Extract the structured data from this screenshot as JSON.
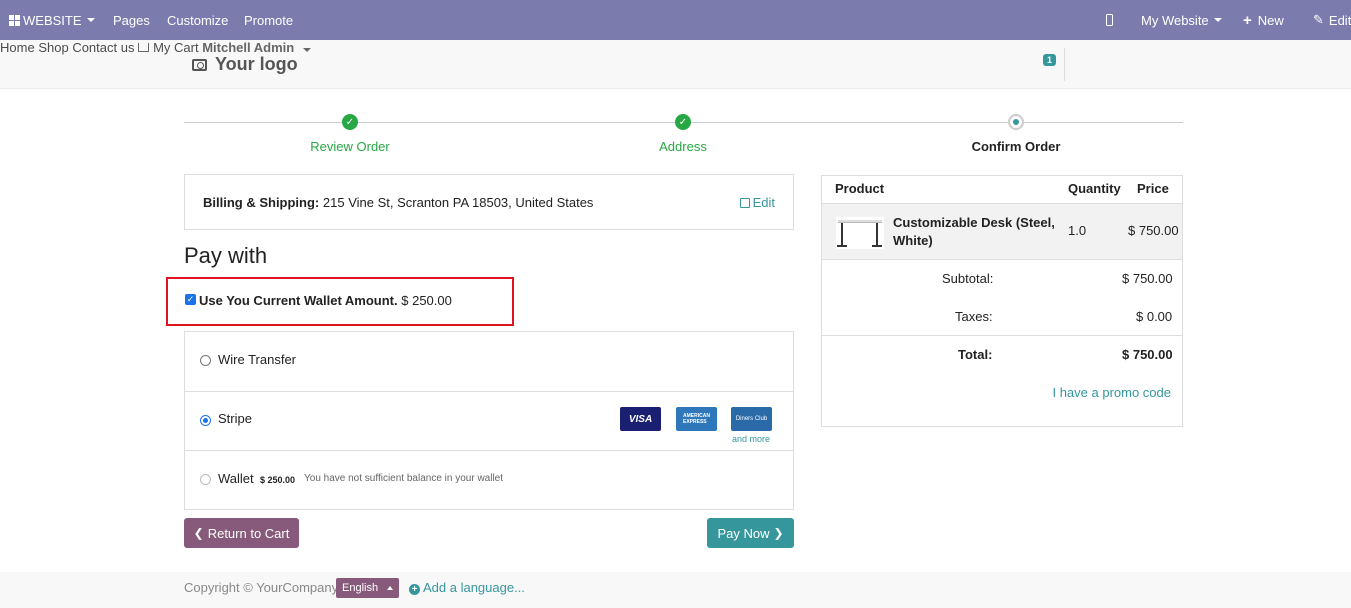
{
  "adminbar": {
    "website_label": "WEBSITE",
    "pages_label": "Pages",
    "customize_label": "Customize",
    "promote_label": "Promote",
    "mywebsite_label": "My Website",
    "new_label": "New",
    "edit_label": "Edit"
  },
  "header": {
    "logo_text": "Your logo",
    "nav": {
      "home": "Home",
      "shop": "Shop",
      "contact": "Contact us",
      "cart": "My Cart",
      "cart_count": "1",
      "user": "Mitchell Admin"
    }
  },
  "steps": [
    {
      "label": "Review Order",
      "state": "done"
    },
    {
      "label": "Address",
      "state": "done"
    },
    {
      "label": "Confirm Order",
      "state": "current"
    }
  ],
  "billing": {
    "label": "Billing & Shipping:",
    "address": "215 Vine St, Scranton PA 18503, United States",
    "edit_label": "Edit"
  },
  "pay_with_title": "Pay with",
  "wallet_checkbox": {
    "checked": true,
    "label": "Use You Current Wallet Amount.",
    "amount": "$ 250.00"
  },
  "payment_options": [
    {
      "name": "Wire Transfer",
      "selected": false
    },
    {
      "name": "Stripe",
      "selected": true,
      "cards": [
        "VISA",
        "AMERICAN EXPRESS",
        "Diners Club"
      ],
      "more_label": "and more"
    },
    {
      "name": "Wallet",
      "selected": false,
      "disabled": true,
      "amount": "$ 250.00",
      "note": "You have not sufficient balance in your wallet"
    }
  ],
  "buttons": {
    "return_label": "Return to Cart",
    "pay_label": "Pay Now"
  },
  "summary": {
    "headers": {
      "product": "Product",
      "quantity": "Quantity",
      "price": "Price"
    },
    "product": {
      "name": "Customizable Desk (Steel, White)",
      "quantity": "1.0",
      "price": "$ 750.00"
    },
    "subtotal_label": "Subtotal:",
    "subtotal": "$ 750.00",
    "taxes_label": "Taxes:",
    "taxes": "$ 0.00",
    "total_label": "Total:",
    "total": "$ 750.00",
    "promo_label": "I have a promo code"
  },
  "footer": {
    "copyright": "Copyright © YourCompany",
    "language": "English",
    "add_language": "Add a language..."
  },
  "colors": {
    "admin_bar": "#7c7bad",
    "primary": "#875a7b",
    "accent": "#35979c",
    "success": "#28a745",
    "highlight_border": "#e0141e"
  }
}
